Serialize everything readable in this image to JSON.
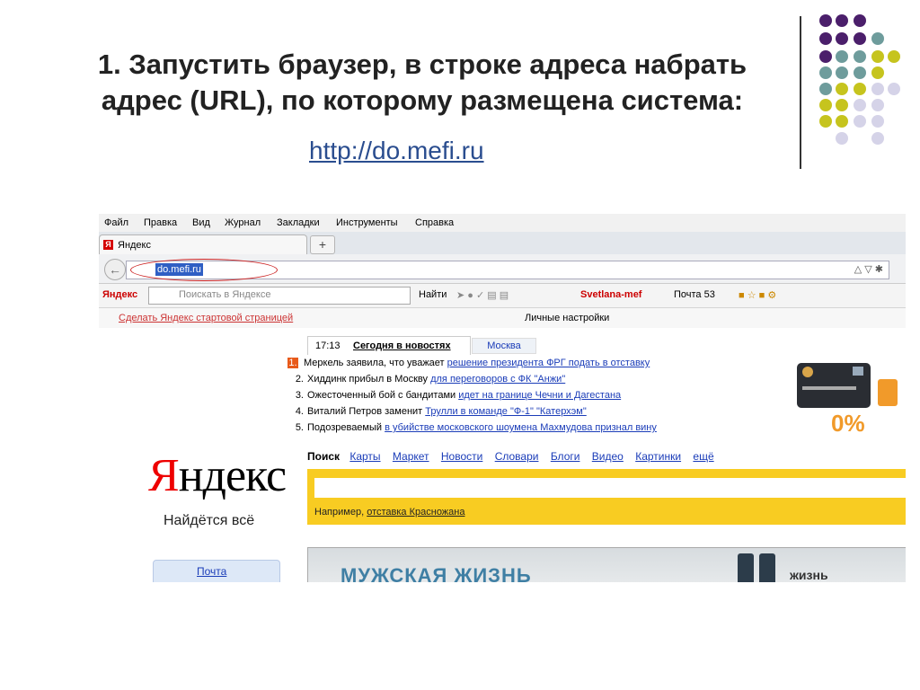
{
  "slide": {
    "title_line1": "1. Запустить браузер, в строке адреса набрать",
    "title_line2": "адрес (URL), по которому размещена система:",
    "url": "http://do.mefi.ru"
  },
  "colors": {
    "purple": "#4b1f6b",
    "teal": "#6e9c9c",
    "olive": "#c6c41e",
    "lavender": "#d5d3e8"
  },
  "browser": {
    "menu": [
      "Файл",
      "Правка",
      "Вид",
      "Журнал",
      "Закладки",
      "Инструменты",
      "Справка"
    ],
    "tab_title": "Яндекс",
    "new_tab": "+",
    "address": "do.mefi.ru",
    "toolbar": {
      "yandex_label": "Яндекс",
      "search_placeholder": "Поискать в Яндексе",
      "find": "Найти",
      "user": "Svetlana-mef",
      "mail": "Почта 53"
    },
    "make_start": "Сделать Яндекс стартовой страницей",
    "personal": "Личные настройки"
  },
  "page": {
    "news_time": "17:13",
    "news_tab": "Сегодня в новостях",
    "region_tab": "Москва",
    "news": [
      {
        "num": "1.",
        "text": "Меркель заявила, что уважает ",
        "link": "решение президента ФРГ подать в отставку"
      },
      {
        "num": "2.",
        "text": "Хиддинк прибыл в Москву ",
        "link": "для переговоров с ФК \"Анжи\""
      },
      {
        "num": "3.",
        "text": "Ожесточенный бой с бандитами ",
        "link": "идет на границе Чечни и Дагестана"
      },
      {
        "num": "4.",
        "text": "Виталий Петров заменит ",
        "link": "Трулли в команде \"Ф-1\" \"Катерхэм\""
      },
      {
        "num": "5.",
        "text": "Подозреваемый ",
        "link": "в убийстве московского шоумена Махмудова признал вину"
      }
    ],
    "card_text": "0%",
    "logo_first": "Я",
    "logo_rest": "ндекс",
    "slogan": "Найдётся всё",
    "search_label": "Поиск",
    "services": [
      "Карты",
      "Маркет",
      "Новости",
      "Словари",
      "Блоги",
      "Видео",
      "Картинки",
      "ещё"
    ],
    "example_label": "Например, ",
    "example_link": "отставка Красножана",
    "mail_link": "Почта",
    "banner_text": "МУЖСКАЯ ЖИЗНЬ",
    "banner_right": "жизнь"
  }
}
